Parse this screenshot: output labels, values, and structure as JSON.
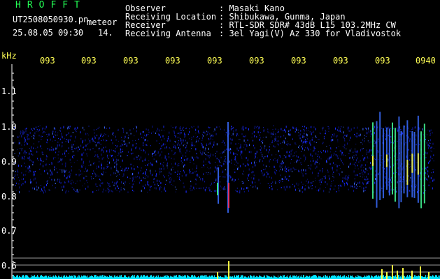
{
  "header": {
    "brand": "HROFFT",
    "filename": "UT2508050930.pn",
    "tag": "meteor",
    "datetime": "25.08.05 09:30",
    "count": "14.",
    "info_labels": [
      "Observer",
      "Receiving Location",
      "Receiver",
      "Receiving Antenna"
    ],
    "info_values": [
      ": Masaki Kano",
      ": Shibukawa, Gunma, Japan",
      ": RTL-SDR SDR# 43dB L15 103.2MHz CW",
      ": 3el Yagi(V) Az 330 for Vladivostok"
    ]
  },
  "axis": {
    "unit": "kHz",
    "y_ticks": [
      "1.1",
      "1.0",
      "0.9",
      "0.8",
      "0.7",
      "0.6"
    ],
    "time_ticks": [
      "093",
      "093",
      "093",
      "093",
      "093",
      "093",
      "093",
      "093",
      "093",
      "0940"
    ]
  },
  "colors": {
    "background": "#000000",
    "text": "#ffffff",
    "tick_text": "#ffff55",
    "brand": "#22ff55",
    "noise": "#1a2cff",
    "echo_hot": "#ff3060",
    "echo_warm": "#ffff40",
    "baseline": "#00e5ff",
    "guide_line": "#9a9a9a"
  }
}
